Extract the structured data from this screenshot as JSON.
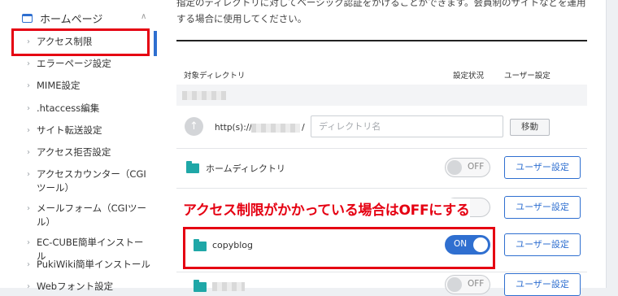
{
  "sidebar": {
    "section_title": "ホームページ",
    "items": [
      {
        "label": "アクセス制限"
      },
      {
        "label": "エラーページ設定"
      },
      {
        "label": "MIME設定"
      },
      {
        "label": ".htaccess編集"
      },
      {
        "label": "サイト転送設定"
      },
      {
        "label": "アクセス拒否設定"
      },
      {
        "label": "アクセスカウンター（CGIツール）"
      },
      {
        "label": "メールフォーム（CGIツール）"
      },
      {
        "label": "EC-CUBE簡単インストール"
      },
      {
        "label": "PukiWiki簡単インストール"
      },
      {
        "label": "Webフォント設定"
      }
    ]
  },
  "main": {
    "description": "指定のディレクトリに対してベーシック認証をかけることができます。会員制のサイトなどを運用する場合に使用してください。",
    "columns": {
      "directory": "対象ディレクトリ",
      "status": "設定状況",
      "user": "ユーザー設定"
    },
    "path_row": {
      "protocol": "http(s)://",
      "slash": "/",
      "placeholder": "ディレクトリ名",
      "move_label": "移動"
    },
    "rows": [
      {
        "name": "ホームディレクトリ",
        "status": "OFF",
        "user_label": "ユーザー設定"
      },
      {
        "name": "",
        "status": "",
        "user_label": "ユーザー設定"
      },
      {
        "name": "copyblog",
        "status": "ON",
        "user_label": "ユーザー設定"
      },
      {
        "name": "",
        "status": "OFF",
        "user_label": "ユーザー設定"
      }
    ],
    "annotation": "アクセス制限がかかっている場合はOFFにする"
  },
  "colors": {
    "accent": "#2f6fd0",
    "highlight": "#e50012",
    "folder": "#1fa7a7"
  }
}
